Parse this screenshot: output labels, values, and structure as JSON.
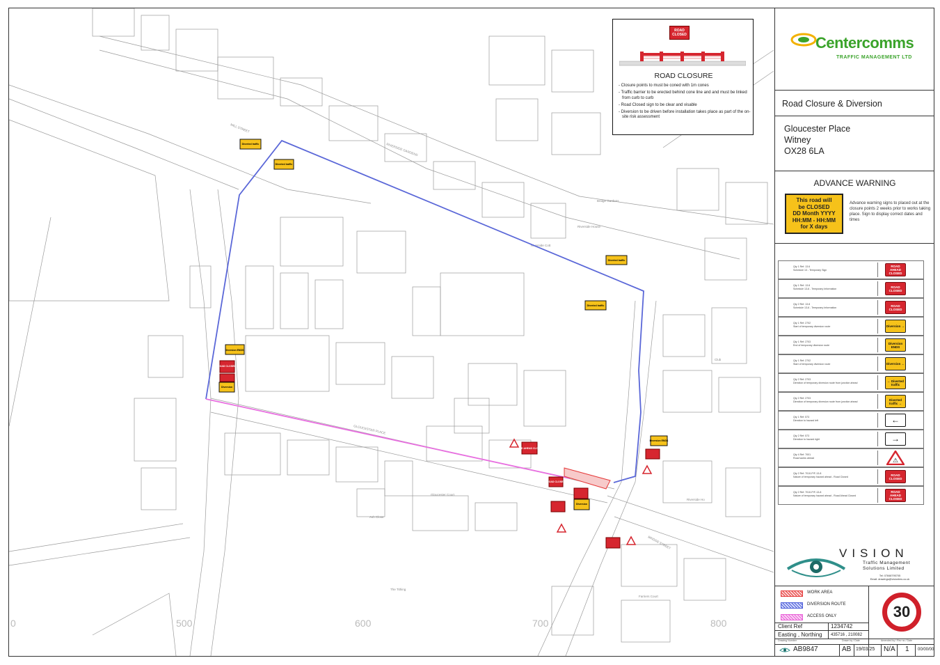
{
  "company": {
    "name": "Centercomms",
    "subtitle": "TRAFFIC MANAGEMENT LTD"
  },
  "project": {
    "title": "Road Closure & Diversion",
    "address": [
      "Gloucester Place",
      "Witney",
      "OX28 6LA"
    ]
  },
  "advance_warning": {
    "title": "ADVANCE WARNING",
    "sign_lines": [
      "This road will",
      "be CLOSED",
      "DD Month YYYY",
      "HH:MM - HH:MM",
      "for X days"
    ],
    "note": "Advance warning signs to placed out at the closure points 2 weeks prior to works taking place. Sign to display correct dates and times"
  },
  "road_closure_box": {
    "sign_text": "ROAD CLOSED",
    "title": "ROAD CLOSURE",
    "notes": [
      "- Closure points to must be coned with 1m cones",
      "- Traffic barrier to be erected behind cone line and and must be linked from curb to curb",
      "- Road Closed sign to be clear and visable",
      "- Diversion to be driven before installation takes place as part of the on-site risk assessment"
    ]
  },
  "signs_schedule": [
    {
      "desc": "Qty 1   Ref: 13.6\nSchedule 13 - Temporary Sign",
      "sign": "ROAD AHEAD CLOSED",
      "style": "red"
    },
    {
      "desc": "Qty 1   Ref: 13.8\nSchedule 13-6 - Temporary Information",
      "sign": "ROAD CLOSED",
      "style": "red"
    },
    {
      "desc": "Qty 2   Ref: 13.8\nSchedule 13-6 - Temporary Information",
      "sign": "ROAD CLOSED",
      "style": "red"
    },
    {
      "desc": "Qty 1   Ref: 2702\nStart of temporary diversion route",
      "sign": "Diversion →",
      "style": "yel"
    },
    {
      "desc": "Qty 1   Ref: 2703\nEnd of temporary diversion route",
      "sign": "Diversion ENDS",
      "style": "yel"
    },
    {
      "desc": "Qty 1   Ref: 2702\nStart of temporary diversion route",
      "sign": "Diversion ←",
      "style": "yel"
    },
    {
      "desc": "Qty 2   Ref: 2703\nDirection of temporary diversion route from junction ahead",
      "sign": "← Diverted traffic",
      "style": "yel"
    },
    {
      "desc": "Qty 2   Ref: 2703\nDirection of temporary diversion route from junction ahead",
      "sign": "Diverted traffic →",
      "style": "yel"
    },
    {
      "desc": "Qty 1   Ref: 573\nDirection to hazard left",
      "sign": "←",
      "style": "wht"
    },
    {
      "desc": "Qty 2   Ref: 573\nDirection to hazard right",
      "sign": "→",
      "style": "wht"
    },
    {
      "desc": "Qty 4   Ref: 7001\nRoad works ahead",
      "sign": "⚠",
      "style": "tri"
    },
    {
      "desc": "Qty 2   Ref: 7010-P/F-13-8\nNature of temporary hazard ahead - Road Closed",
      "sign": "ROAD CLOSED",
      "style": "red"
    },
    {
      "desc": "Qty 2   Ref: 7010-P/F-13-8\nNature of temporary hazard ahead - Road Ahead Closed",
      "sign": "ROAD AHEAD CLOSED",
      "style": "red"
    }
  ],
  "vision": {
    "name": "VISION",
    "sub": [
      "Traffic Management",
      "Solutions Limited"
    ],
    "contact": [
      "Tel: 07848795705",
      "Email: drawings@visiontms.co.uk"
    ]
  },
  "legend": [
    {
      "label": "WORK AREA",
      "color": "#e53939"
    },
    {
      "label": "DIVERSION ROUTE",
      "color": "#4a5bd8"
    },
    {
      "label": "ACCESS ONLY",
      "color": "#e85fd6"
    }
  ],
  "speed_limit": "30",
  "title_block": {
    "client_ref_label": "Client Ref",
    "client_ref": "1234742",
    "easting_label": "Easting , Northing",
    "easting": "435716 , 210082",
    "drawing_number_label": "Drawing Number",
    "drawing_number": "AB9847",
    "drawn_by_label": "Drawn by / Date",
    "drawn_by": "AB",
    "date": "19/03/25",
    "amended_label": "Amended by / Rev no / Date",
    "amended_by": "N/A",
    "rev": "1",
    "rev_date": "00/00/00"
  },
  "map": {
    "grid_labels": [
      "0",
      "500",
      "600",
      "700",
      "800"
    ],
    "street_labels": [
      "MILL STREET",
      "RIVERSIDE GARDENS",
      "GLOUCESTER PLACE",
      "Gloucester Court",
      "Ash Close",
      "The Tithing",
      "Riverside Cott",
      "Bridge Gardens",
      "Riverside House",
      "Farriers Court",
      "BRIDGE STREET",
      "Riverside Ho",
      "Club"
    ],
    "signs": {
      "diverted_traffic": "Diverted traffic",
      "diversion": "Diversion",
      "diversion_ends": "Diversion ENDS",
      "road_closed": "ROAD CLOSED",
      "road_ahead_closed": "ROAD AHEAD CLOSED"
    }
  }
}
